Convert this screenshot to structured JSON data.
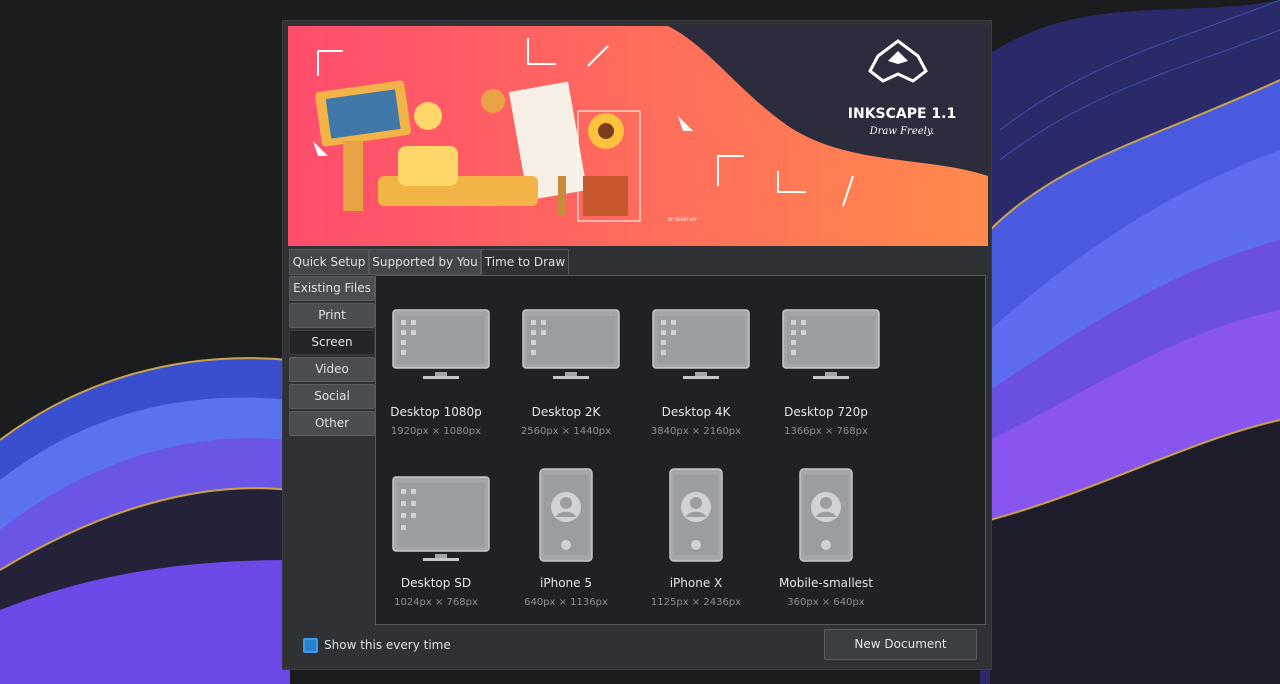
{
  "banner": {
    "title": "INKSCAPE 1.1",
    "tagline": "Draw Freely.",
    "credit": "BY: DEANTUAY"
  },
  "tabs": [
    {
      "label": "Quick Setup"
    },
    {
      "label": "Supported by You"
    },
    {
      "label": "Time to Draw"
    }
  ],
  "categories": [
    {
      "label": "Existing Files"
    },
    {
      "label": "Print"
    },
    {
      "label": "Screen"
    },
    {
      "label": "Video"
    },
    {
      "label": "Social"
    },
    {
      "label": "Other"
    }
  ],
  "selected_category": "Screen",
  "templates": [
    {
      "name": "Desktop 1080p",
      "size": "1920px × 1080px",
      "icon": "monitor-icon"
    },
    {
      "name": "Desktop 2K",
      "size": "2560px × 1440px",
      "icon": "monitor-icon"
    },
    {
      "name": "Desktop 4K",
      "size": "3840px × 2160px",
      "icon": "monitor-icon"
    },
    {
      "name": "Desktop 720p",
      "size": "1366px × 768px",
      "icon": "monitor-icon"
    },
    {
      "name": "Desktop SD",
      "size": "1024px × 768px",
      "icon": "monitor-icon"
    },
    {
      "name": "iPhone 5",
      "size": "640px × 1136px",
      "icon": "phone-icon"
    },
    {
      "name": "iPhone X",
      "size": "1125px × 2436px",
      "icon": "phone-icon"
    },
    {
      "name": "Mobile-smallest",
      "size": "360px × 640px",
      "icon": "phone-icon"
    }
  ],
  "footer": {
    "show_every_time_label": "Show this every time",
    "show_every_time_checked": true,
    "new_document_label": "New Document"
  },
  "colors": {
    "banner_gradient_start": "#ff4d6d",
    "banner_gradient_end": "#ff8a4c",
    "banner_dark": "#2d2c3c",
    "accent": "#2a80d0"
  }
}
